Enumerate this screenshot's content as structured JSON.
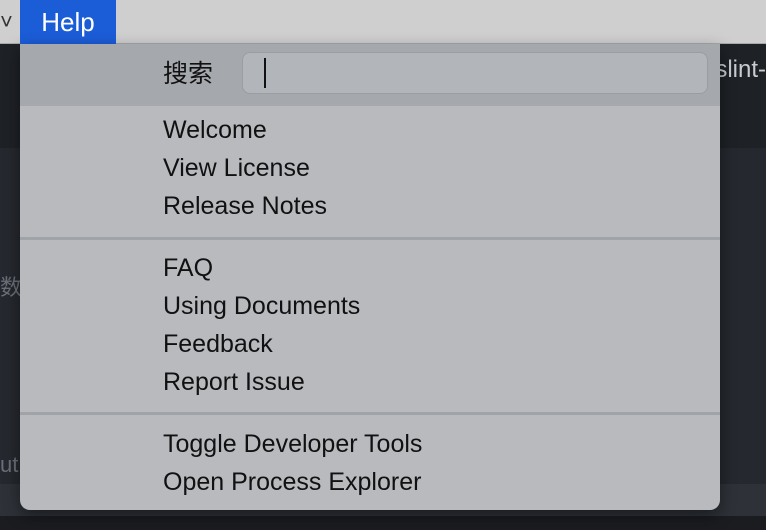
{
  "menubar": {
    "edge_glyph": "˅",
    "help_label": "Help"
  },
  "editor": {
    "tab_text": "slint-",
    "side_text_1": "数",
    "side_text_2": "ut"
  },
  "help_menu": {
    "search": {
      "label": "搜索",
      "value": "",
      "placeholder": ""
    },
    "groups": [
      {
        "items": [
          {
            "label": "Welcome"
          },
          {
            "label": "View License"
          },
          {
            "label": "Release Notes"
          }
        ]
      },
      {
        "items": [
          {
            "label": "FAQ"
          },
          {
            "label": "Using Documents"
          },
          {
            "label": "Feedback"
          },
          {
            "label": "Report Issue"
          }
        ]
      },
      {
        "items": [
          {
            "label": "Toggle Developer Tools"
          },
          {
            "label": "Open Process Explorer"
          }
        ]
      }
    ]
  },
  "colors": {
    "menubar_highlight": "#1b5cd7",
    "menu_background": "#b8babe",
    "editor_background": "#25282e"
  }
}
